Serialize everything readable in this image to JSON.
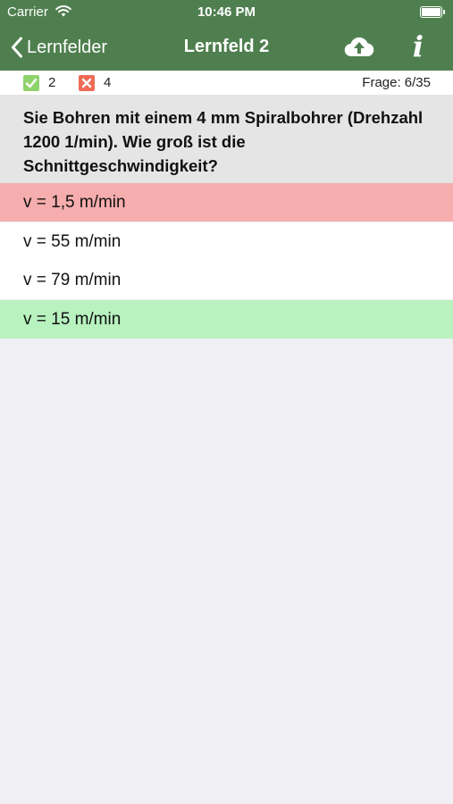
{
  "status": {
    "carrier": "Carrier",
    "time": "10:46 PM"
  },
  "nav": {
    "back_label": "Lernfelder",
    "title": "Lernfeld 2",
    "info_label": "i"
  },
  "score": {
    "correct": "2",
    "wrong": "4",
    "progress": "Frage: 6/35"
  },
  "question": "Sie Bohren mit einem 4 mm Spiralbohrer (Drehzahl 1200 1/min). Wie groß ist die Schnittgeschwindigkeit?",
  "answers": [
    {
      "text": "v = 1,5 m/min",
      "state": "wrong"
    },
    {
      "text": "v = 55 m/min",
      "state": "neutral"
    },
    {
      "text": "v = 79 m/min",
      "state": "neutral"
    },
    {
      "text": "v = 15 m/min",
      "state": "correct"
    }
  ],
  "colors": {
    "bar": "#4f7f4f",
    "wrong_answer": "#f6adad",
    "correct_answer": "#b8f2bf",
    "question_bg": "#e5e5e5",
    "background": "#efeff4"
  },
  "icons": [
    "wifi-icon",
    "battery-icon",
    "back-chevron-icon",
    "cloud-upload-icon",
    "info-icon",
    "checkmark-icon",
    "cross-icon"
  ]
}
